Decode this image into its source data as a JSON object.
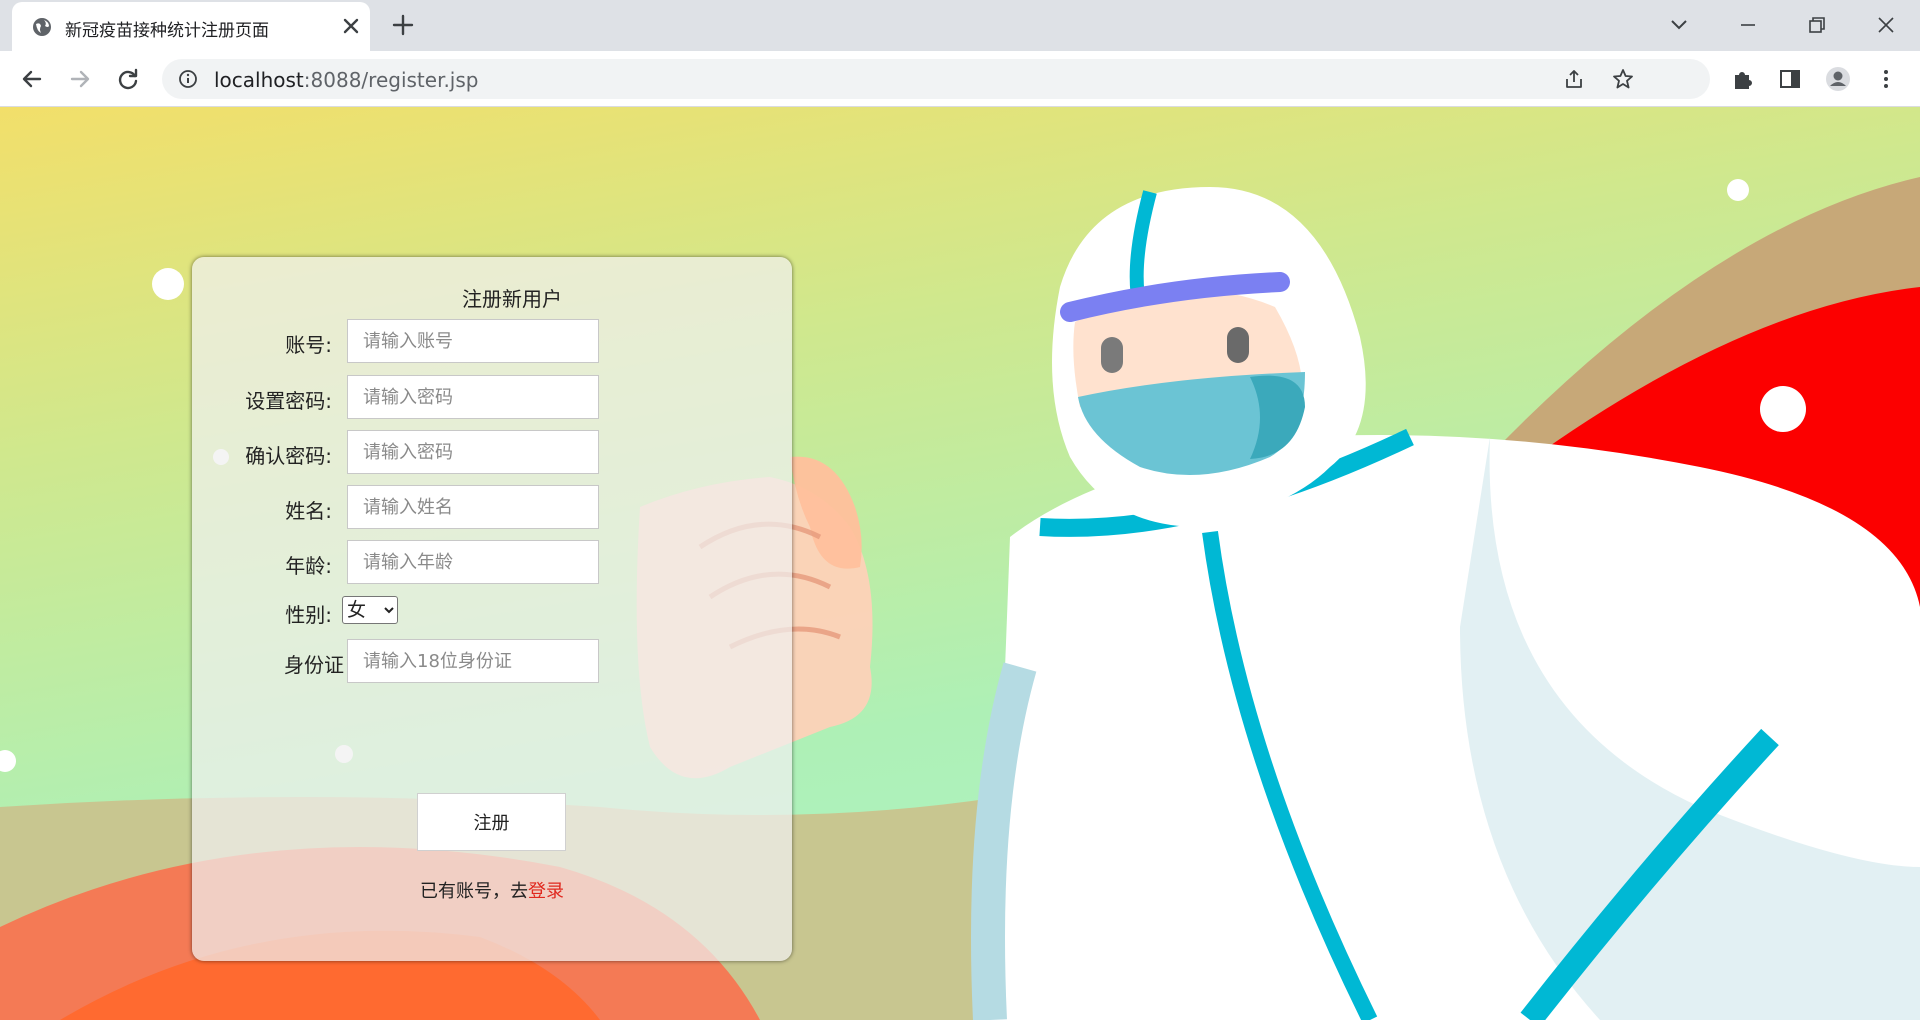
{
  "browser": {
    "tab_title": "新冠疫苗接种统计注册页面",
    "url_host": "localhost",
    "url_rest": ":8088/register.jsp"
  },
  "form": {
    "title": "注册新用户",
    "fields": [
      {
        "label": "账号:",
        "placeholder": "请输入账号"
      },
      {
        "label": "设置密码:",
        "placeholder": "请输入密码"
      },
      {
        "label": "确认密码:",
        "placeholder": "请输入密码"
      },
      {
        "label": "姓名:",
        "placeholder": "请输入姓名"
      },
      {
        "label": "年龄:",
        "placeholder": "请输入年龄"
      }
    ],
    "gender_label": "性别:",
    "gender_selected": "女",
    "id_label": "身份证",
    "id_placeholder": "请输入18位身份证",
    "submit_label": "注册",
    "login_prompt": "已有账号，去",
    "login_link": "登录"
  },
  "colors": {
    "accent_link": "#e0281e",
    "suit_trim": "#00b8d4"
  }
}
